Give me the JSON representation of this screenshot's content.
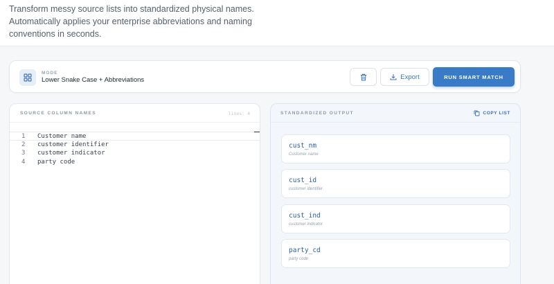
{
  "hero": {
    "description": "Transform messy source lists into standardized physical names. Automatically applies your enterprise abbreviations and naming conventions in seconds."
  },
  "toolbar": {
    "mode_label": "MODE",
    "mode_value": "Lower Snake Case + Abbreviations",
    "export_label": "Export",
    "run_label": "RUN SMART MATCH"
  },
  "source": {
    "title": "SOURCE COLUMN NAMES",
    "lines_label": "lines: 4",
    "lines": [
      {
        "num": "1",
        "text": "Customer name"
      },
      {
        "num": "2",
        "text": "customer identifier"
      },
      {
        "num": "3",
        "text": "customer indicator"
      },
      {
        "num": "4",
        "text": "party code"
      }
    ]
  },
  "output": {
    "title": "STANDARDIZED OUTPUT",
    "copy_label": "COPY LIST",
    "items": [
      {
        "name": "cust_nm",
        "source": "Customer name"
      },
      {
        "name": "cust_id",
        "source": "customer identifier"
      },
      {
        "name": "cust_ind",
        "source": "customer indicator"
      },
      {
        "name": "party_cd",
        "source": "party code"
      }
    ]
  },
  "colors": {
    "accent": "#3a7bc8",
    "output_name": "#2e5f9c"
  }
}
